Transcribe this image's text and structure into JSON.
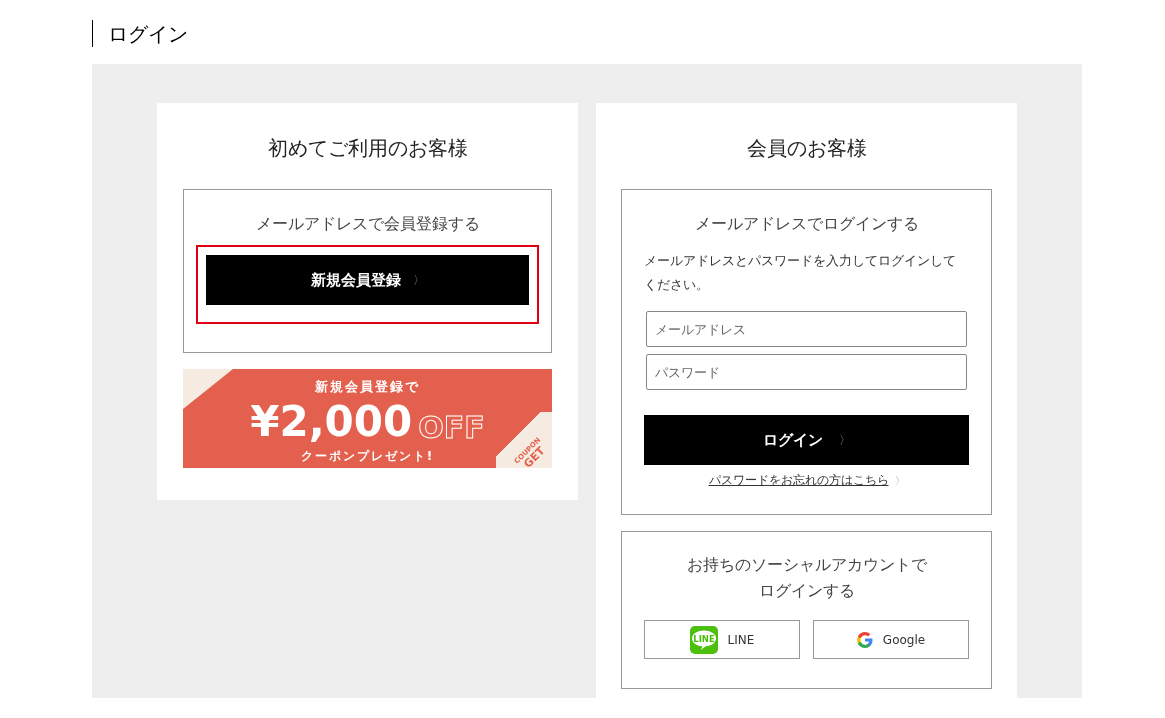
{
  "page_title": "ログイン",
  "new_customer": {
    "title": "初めてご利用のお客様",
    "box_title": "メールアドレスで会員登録する",
    "register_button": {
      "label": "新規会員登録",
      "arrow": "〉",
      "highlighted": true
    },
    "coupon_banner": {
      "headline": "新規会員登録で",
      "amount": "¥2,000",
      "off": "OFF",
      "subline": "クーポンプレゼント!",
      "corner_top": "COUPON",
      "corner_bottom": "GET"
    }
  },
  "member": {
    "title": "会員のお客様",
    "box_title": "メールアドレスでログインする",
    "description": "メールアドレスとパスワードを入力してログインしてください。",
    "fields": [
      {
        "placeholder": "メールアドレス"
      },
      {
        "placeholder": "パスワード"
      }
    ],
    "login_button": {
      "label": "ログイン",
      "arrow": "〉"
    },
    "forgot_link": {
      "label": "パスワードをお忘れの方はこちら",
      "arrow": "〉"
    },
    "social": {
      "title": "お持ちのソーシャルアカウントでログインする",
      "buttons": [
        {
          "kind": "line",
          "label": "LINE",
          "icon_text": "LINE"
        },
        {
          "kind": "google",
          "label": "Google"
        }
      ]
    }
  }
}
